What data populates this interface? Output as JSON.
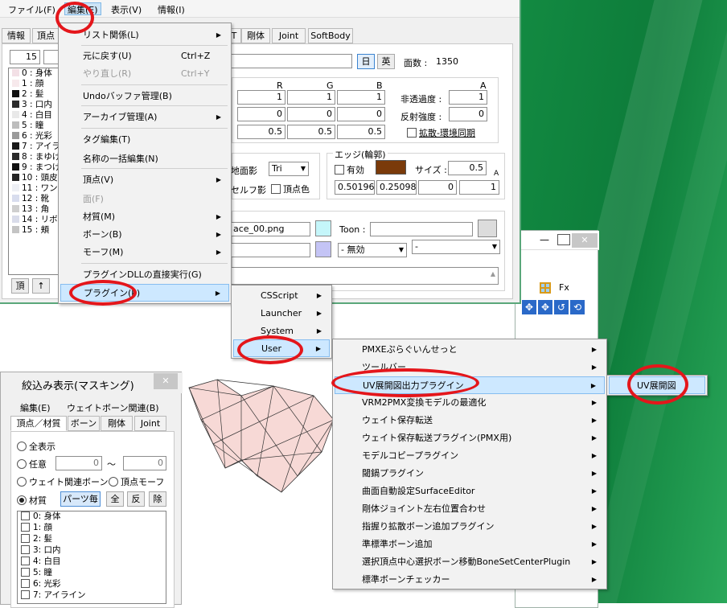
{
  "main_menu": [
    "ファイル(F)",
    "編集(E)",
    "表示(V)",
    "情報(I)"
  ],
  "main_tabs": [
    "情報",
    "頂点",
    "Ｔ",
    "剛体",
    "Joint",
    "SoftBody"
  ],
  "morph_num": "15",
  "list_items": [
    "0 : 身体",
    "1 : 顔",
    "2 : 髪",
    "3 : 口内",
    "4 : 白目",
    "5 : 瞳",
    "6 : 光彩",
    "7 : アイラ",
    "8 : まゆげ",
    "9 : まつげ",
    "10 : 頭皮",
    "11 : ワンピ",
    "12 : 靴",
    "13 : 角",
    "14 : リボン",
    "15 : 頬"
  ],
  "list_colors": [
    "#f3e0e6",
    "#f7e9ec",
    "#111111",
    "#2b2b2b",
    "#e9e9e9",
    "#bdbdbd",
    "#9a9a9a",
    "#1a1a1a",
    "#2a2a2a",
    "#101010",
    "#242424",
    "#eef0f5",
    "#d8ddee",
    "#cfcfcf",
    "#d9dcea",
    "#c4c4c4"
  ],
  "name_btn_ja": "日",
  "name_btn_en": "英",
  "face_count_label": "面数 :",
  "face_count": "1350",
  "rgb_headers": [
    "R",
    "G",
    "B",
    "A"
  ],
  "diffuse_values": [
    "1",
    "1",
    "1"
  ],
  "specular_values": [
    "0",
    "0",
    "0"
  ],
  "ambient_values": [
    "0.5",
    "0.5",
    "0.5"
  ],
  "alpha_label": "非透過度 :",
  "alpha_value": "1",
  "specular_power_label": "反射強度 :",
  "specular_power_value": "0",
  "sync_label": "拡散-環境同期",
  "shadow_label": "地面影",
  "shadow_value": "Tri",
  "selfshadow_label": "セルフ影",
  "vertex_color_label": "頂点色",
  "edge_group_label": "エッジ(輪郭)",
  "edge_enabled_label": "有効",
  "edge_size_label": "サイズ :",
  "edge_size_value": "0.5",
  "edge_a_label": "A",
  "edge_values": [
    "0.501960",
    "0.250980",
    "0",
    "1"
  ],
  "texture_value": "ace_00.png",
  "toon_label": "Toon :",
  "sphere_mode": "- 無効",
  "toon_select": "-",
  "bottom_btns": [
    "頂",
    "↑"
  ],
  "edit_menu": {
    "items": [
      {
        "label": "リスト関係(L)",
        "arrow": true
      },
      {
        "label": "元に戻す(U)",
        "shortcut": "Ctrl+Z"
      },
      {
        "label": "やり直し(R)",
        "shortcut": "Ctrl+Y",
        "disabled": true
      },
      {
        "label": "Undoバッファ管理(B)"
      },
      {
        "label": "アーカイブ管理(A)",
        "arrow": true
      },
      {
        "label": "タグ編集(T)"
      },
      {
        "label": "名称の一括編集(N)"
      },
      {
        "label": "頂点(V)",
        "arrow": true
      },
      {
        "label": "面(F)",
        "disabled": true
      },
      {
        "label": "材質(M)",
        "arrow": true
      },
      {
        "label": "ボーン(B)",
        "arrow": true
      },
      {
        "label": "モーフ(M)",
        "arrow": true
      },
      {
        "label": "プラグインDLLの直接実行(G)"
      },
      {
        "label": "プラグイン(P)",
        "arrow": true
      }
    ]
  },
  "plugin_menu": [
    "CSScript",
    "Launcher",
    "System",
    "User"
  ],
  "user_menu": [
    "PMXEぷらぐいんせっと",
    "ツールバー",
    "UV展開図出力プラグイン",
    "VRM2PMX変換モデルの最適化",
    "ウェイト保存転送",
    "ウェイト保存転送プラグイン(PMX用)",
    "モデルコピープラグイン",
    "閾鍋プラグイン",
    "曲面自動設定SurfaceEditor",
    "剛体ジョイント左右位置合わせ",
    "指握り拡散ボーン追加プラグイン",
    "準標準ボーン追加",
    "選択頂点中心選択ボーン移動BoneSetCenterPlugin",
    "標準ボーンチェッカー"
  ],
  "uv_submenu": "UV展開図",
  "view_toolbar_fx": "Fx",
  "mask_window": {
    "title": "絞込み表示(マスキング)",
    "close": "✕",
    "menu": [
      "編集(E)",
      "ウェイトボーン関連(B)"
    ],
    "tabs": [
      "頂点／材質",
      "ボーン",
      "剛体",
      "Joint"
    ],
    "opt_all": "全表示",
    "opt_any": "任意",
    "any_from": "0",
    "tilde": "～",
    "any_to": "0",
    "opt_weight": "ウェイト関連ボーン",
    "opt_vmorph": "頂点モーフ",
    "opt_material": "材質",
    "btn_parts": "パーツ毎",
    "btn_all": "全",
    "btn_inv": "反",
    "btn_rem": "除",
    "materials": [
      "0: 身体",
      "1: 顔",
      "2: 髪",
      "3: 口内",
      "4: 白目",
      "5: 瞳",
      "6: 光彩",
      "7: アイライン"
    ]
  },
  "view_win_close": "✕"
}
